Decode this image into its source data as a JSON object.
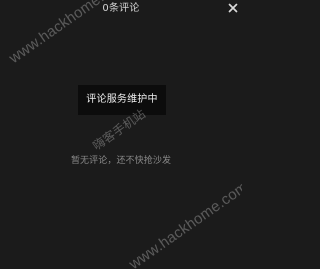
{
  "header": {
    "title": "0条评论",
    "close_icon": "close-icon"
  },
  "toast": {
    "message": "评论服务维护中"
  },
  "empty_state": {
    "message": "暂无评论，还不快抢沙发"
  },
  "watermarks": [
    "www.hackhome.com",
    "嗨客手机站",
    "www.hackhome.com"
  ]
}
